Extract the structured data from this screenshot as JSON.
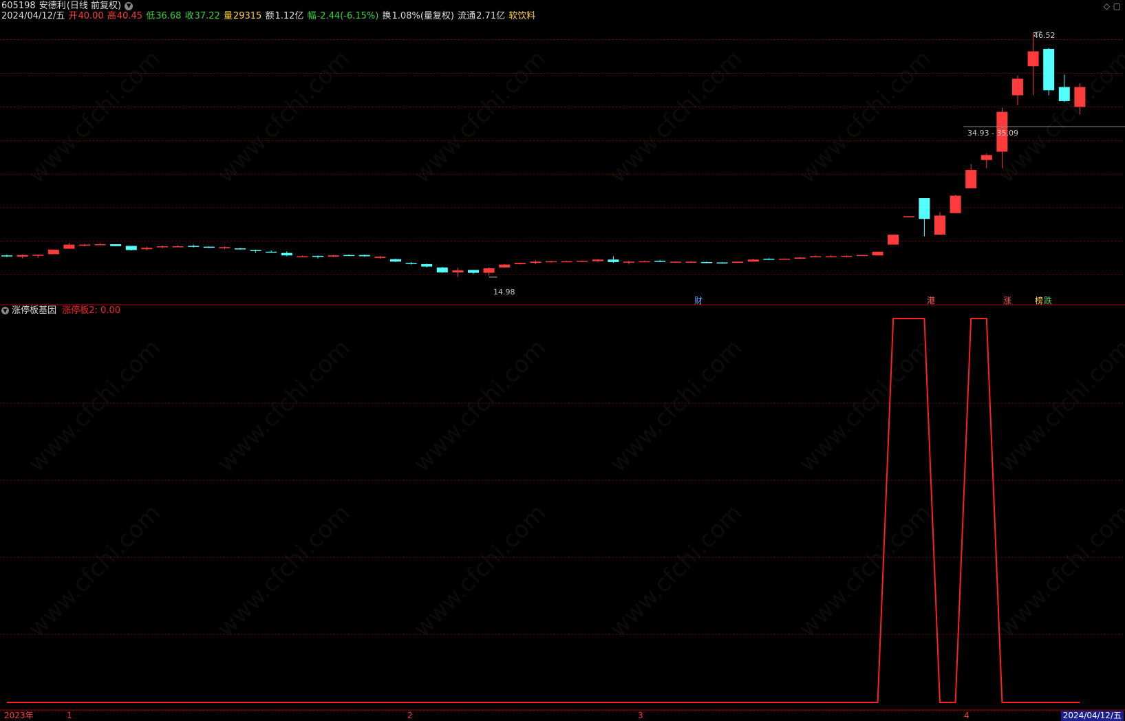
{
  "header": {
    "code": "605198",
    "name": "安德利",
    "period": "(日线 前复权)",
    "date": "2024/04/12/五",
    "open_label": "开",
    "open": "40.00",
    "high_label": "高",
    "high": "40.45",
    "low_label": "低",
    "low": "36.68",
    "close_label": "收",
    "close": "37.22",
    "vol_label": "量",
    "vol": "29315",
    "amt_label": "额",
    "amt": "1.12亿",
    "chg_label": "幅",
    "chg": "-2.44(-6.15%)",
    "turnover_label": "换",
    "turnover": "1.08%(量复权)",
    "float_label": "流通",
    "float": "2.71亿",
    "sector": "软饮料"
  },
  "indicator": {
    "name": "涨停板基因",
    "series_label": "涨停板2",
    "series_value": "0.00"
  },
  "annotations": {
    "high_label": "46.52",
    "low_label": "14.98",
    "range_label": "34.93 - 35.09"
  },
  "markers": [
    {
      "text": "财",
      "color": "#6aa6ff"
    },
    {
      "text": "港",
      "color": "#ff5555"
    },
    {
      "text": "涨",
      "color": "#ff5555"
    },
    {
      "text": "榜",
      "color": "#ffd24a"
    },
    {
      "text": "跌",
      "color": "#5ad65a"
    }
  ],
  "x_axis": {
    "year_label": "2023年",
    "months": [
      "1",
      "2",
      "3",
      "4"
    ],
    "current_date": "2024/04/12/五"
  },
  "watermark": "www.cfchi.com",
  "colors": {
    "up": "#ff3b3b",
    "down": "#54ffff",
    "grid": "#7a0000",
    "line": "#ff2020",
    "label_green": "#35d335",
    "label_yellow": "#ffd24a"
  },
  "chart_data": {
    "type": "candlestick",
    "ohlc": [
      [
        19.7,
        19.8,
        19.5,
        19.62
      ],
      [
        19.55,
        19.8,
        19.35,
        19.75
      ],
      [
        19.7,
        19.8,
        19.4,
        19.78
      ],
      [
        19.85,
        20.4,
        19.85,
        20.4
      ],
      [
        20.5,
        21.2,
        20.5,
        21.0
      ],
      [
        20.9,
        21.1,
        20.8,
        21.0
      ],
      [
        21.05,
        21.15,
        20.95,
        21.05
      ],
      [
        21.05,
        21.05,
        20.8,
        20.82
      ],
      [
        20.85,
        20.85,
        20.3,
        20.35
      ],
      [
        20.45,
        20.75,
        20.35,
        20.62
      ],
      [
        20.7,
        20.9,
        20.55,
        20.8
      ],
      [
        20.8,
        20.9,
        20.75,
        20.8
      ],
      [
        20.85,
        21.0,
        20.65,
        20.75
      ],
      [
        20.75,
        20.8,
        20.6,
        20.7
      ],
      [
        20.65,
        20.8,
        20.45,
        20.7
      ],
      [
        20.55,
        20.6,
        20.4,
        20.45
      ],
      [
        20.35,
        20.4,
        20.0,
        20.25
      ],
      [
        20.15,
        20.3,
        20.05,
        20.1
      ],
      [
        20.0,
        20.2,
        19.6,
        19.7
      ],
      [
        19.6,
        19.7,
        19.5,
        19.6
      ],
      [
        19.65,
        19.7,
        19.35,
        19.58
      ],
      [
        19.55,
        19.75,
        19.5,
        19.7
      ],
      [
        19.75,
        19.8,
        19.65,
        19.7
      ],
      [
        19.75,
        19.8,
        19.55,
        19.6
      ],
      [
        19.4,
        19.65,
        19.3,
        19.55
      ],
      [
        19.25,
        19.3,
        18.9,
        18.95
      ],
      [
        18.8,
        18.9,
        18.6,
        18.7
      ],
      [
        18.65,
        18.7,
        18.25,
        18.35
      ],
      [
        18.25,
        18.3,
        17.6,
        17.65
      ],
      [
        17.65,
        18.2,
        17.1,
        17.9
      ],
      [
        17.95,
        17.95,
        17.45,
        17.6
      ],
      [
        17.6,
        18.25,
        17.25,
        18.15
      ],
      [
        18.25,
        18.65,
        18.25,
        18.6
      ],
      [
        18.65,
        18.85,
        18.6,
        18.8
      ],
      [
        18.8,
        19.1,
        18.65,
        18.95
      ],
      [
        18.95,
        19.05,
        18.8,
        19.0
      ],
      [
        18.95,
        19.05,
        18.95,
        19.0
      ],
      [
        19.0,
        19.1,
        18.9,
        19.05
      ],
      [
        19.0,
        19.25,
        18.9,
        19.2
      ],
      [
        19.2,
        19.6,
        18.8,
        18.9
      ],
      [
        18.9,
        19.05,
        18.6,
        18.95
      ],
      [
        18.95,
        19.05,
        18.9,
        19.0
      ],
      [
        19.05,
        19.15,
        18.9,
        18.95
      ],
      [
        18.95,
        19.0,
        18.85,
        18.95
      ],
      [
        18.9,
        19.0,
        18.8,
        18.95
      ],
      [
        18.9,
        18.95,
        18.8,
        18.85
      ],
      [
        18.85,
        18.9,
        18.75,
        18.8
      ],
      [
        18.8,
        18.95,
        18.8,
        18.95
      ],
      [
        18.95,
        19.3,
        18.95,
        19.2
      ],
      [
        19.3,
        19.35,
        19.15,
        19.2
      ],
      [
        19.25,
        19.35,
        19.25,
        19.3
      ],
      [
        19.3,
        19.5,
        19.3,
        19.45
      ],
      [
        19.5,
        19.7,
        19.5,
        19.6
      ],
      [
        19.6,
        19.75,
        19.55,
        19.6
      ],
      [
        19.6,
        19.7,
        19.5,
        19.65
      ],
      [
        19.7,
        19.75,
        19.65,
        19.75
      ],
      [
        19.7,
        20.15,
        19.7,
        20.15
      ],
      [
        21.0,
        22.2,
        21.0,
        22.2
      ],
      [
        24.42,
        24.45,
        24.4,
        24.42
      ],
      [
        26.6,
        26.6,
        22.0,
        24.1
      ],
      [
        22.2,
        24.9,
        22.2,
        24.5
      ],
      [
        24.8,
        27.0,
        24.8,
        26.9
      ],
      [
        27.8,
        30.7,
        27.8,
        30.0
      ],
      [
        31.2,
        32.0,
        30.2,
        31.8
      ],
      [
        32.2,
        37.5,
        30.2,
        37.0
      ],
      [
        39.0,
        41.4,
        37.8,
        41.0
      ],
      [
        42.5,
        46.52,
        39.0,
        44.3
      ],
      [
        44.6,
        44.7,
        39.0,
        39.6
      ],
      [
        40.0,
        41.5,
        38.2,
        38.3
      ],
      [
        37.6,
        40.45,
        36.68,
        40.0
      ]
    ],
    "price_ticks": [
      17.35,
      21.4,
      25.45,
      29.5,
      33.55,
      37.6,
      41.65,
      45.7
    ],
    "indicator_values": [
      0,
      0,
      0,
      0,
      0,
      0,
      0,
      0,
      0,
      0,
      0,
      0,
      0,
      0,
      0,
      0,
      0,
      0,
      0,
      0,
      0,
      0,
      0,
      0,
      0,
      0,
      0,
      0,
      0,
      0,
      0,
      0,
      0,
      0,
      0,
      0,
      0,
      0,
      0,
      0,
      0,
      0,
      0,
      0,
      0,
      0,
      0,
      0,
      0,
      0,
      0,
      0,
      0,
      0,
      0,
      0,
      0,
      1,
      1,
      1,
      0,
      0,
      1,
      1,
      0,
      0,
      0,
      0,
      0,
      0
    ],
    "indicator_ylim": [
      0,
      1
    ]
  }
}
